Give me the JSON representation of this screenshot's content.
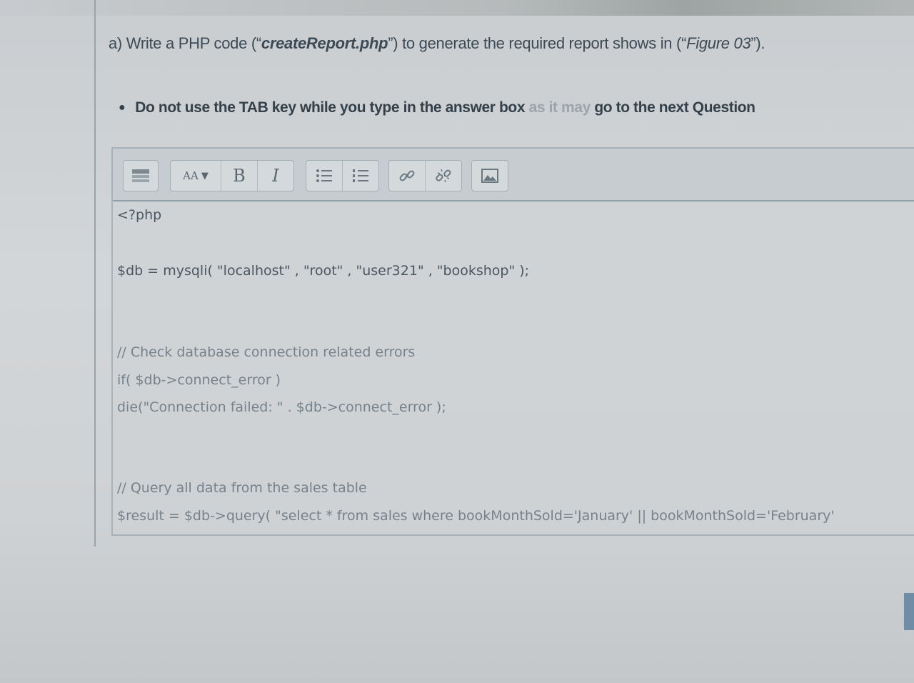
{
  "question": {
    "prefix": "a) Write a PHP code (“",
    "filename": "createReport.php",
    "middle": "”) to generate the required report shows in (“",
    "figure": "Figure 03",
    "suffix": "”)."
  },
  "note": {
    "text": "Do not use the TAB key while you type in the answer box",
    "faded_text": "as it may",
    "tail": "go to the next Question"
  },
  "toolbar": {
    "font_size_label": "AA",
    "bold_label": "B",
    "italic_label": "I"
  },
  "editor": {
    "lines": [
      "<?php",
      "$db = mysqli( \"localhost\" , \"root\" , \"user321\" , \"bookshop\" );",
      "// Check database connection related errors",
      "if( $db->connect_error )",
      "die(\"Connection failed: \" . $db->connect_error );",
      "// Query all data from the sales table",
      "$result = $db->query( \"select * from sales where bookMonthSold='January' || bookMonthSold='February'"
    ]
  }
}
